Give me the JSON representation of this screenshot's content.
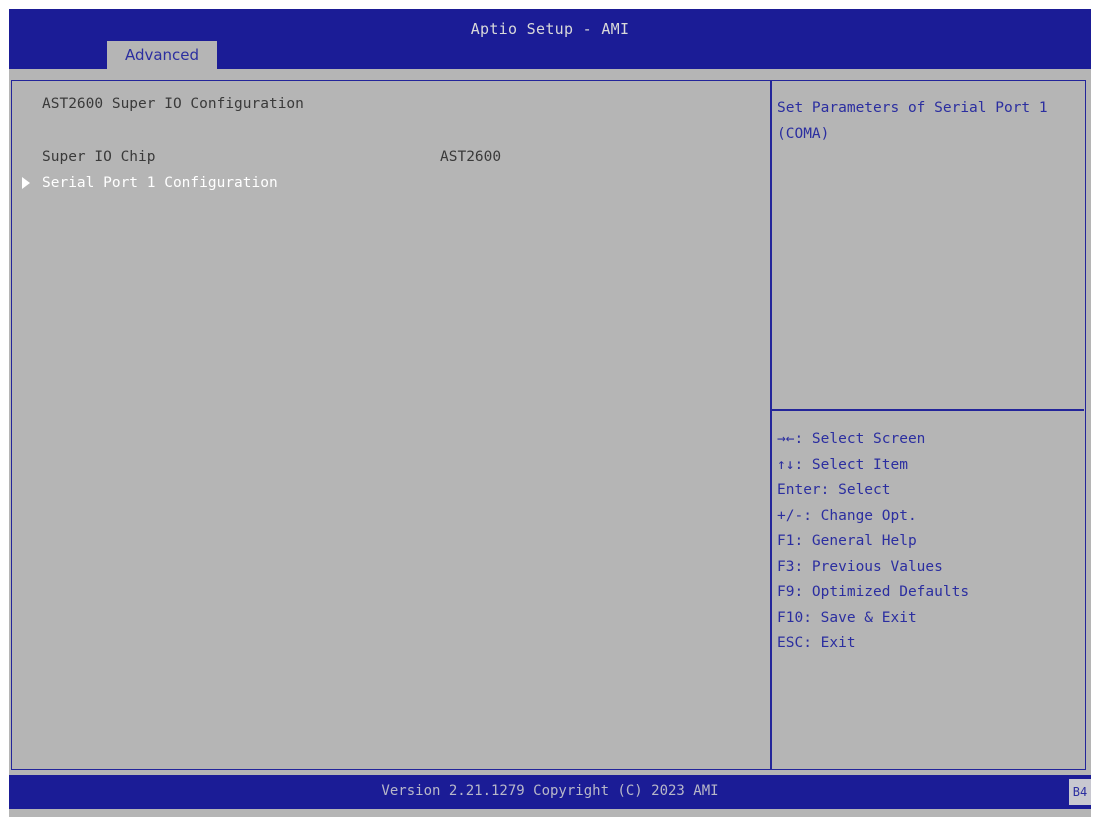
{
  "header": {
    "app_title": "Aptio Setup - AMI",
    "active_tab": "Advanced"
  },
  "main": {
    "page_title": "AST2600 Super IO Configuration",
    "items": [
      {
        "label": "Super IO Chip",
        "value": "AST2600"
      },
      {
        "label": "Serial Port 1 Configuration"
      }
    ]
  },
  "help": {
    "text": "Set Parameters of Serial Port 1 (COMA)"
  },
  "keys": [
    "→←: Select Screen",
    "↑↓: Select Item",
    "Enter: Select",
    "+/-: Change Opt.",
    "F1: General Help",
    "F3: Previous Values",
    "F9: Optimized Defaults",
    "F10: Save & Exit",
    "ESC: Exit"
  ],
  "footer": {
    "text": "Version 2.21.1279 Copyright (C) 2023 AMI",
    "code": "B4"
  },
  "colors": {
    "header_bg": "#1b1c96",
    "panel_bg": "#b5b5b5",
    "accent_text": "#2b2ea0",
    "selected_text": "#ffffff"
  }
}
